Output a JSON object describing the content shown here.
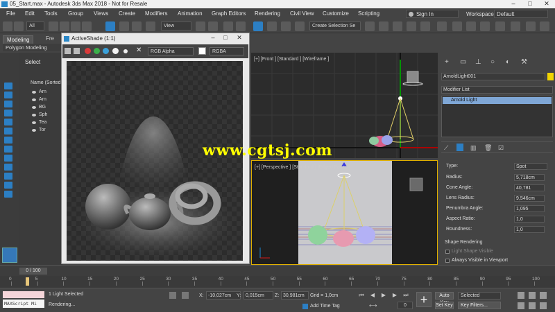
{
  "window": {
    "title": "05_Start.max - Autodesk 3ds Max 2018 - Not for Resale"
  },
  "menu": {
    "items": [
      "File",
      "Edit",
      "Tools",
      "Group",
      "Views",
      "Create",
      "Modifiers",
      "Animation",
      "Graph Editors",
      "Rendering",
      "Civil View",
      "Customize",
      "Scripting"
    ],
    "sign_in": "Sign In",
    "workspaces_label": "Workspaces:",
    "workspace_value": "Default"
  },
  "toolbar": {
    "filter_value": "All",
    "view_value": "View",
    "selection_set": "Create Selection Se"
  },
  "ribbon": {
    "tabs": [
      "Modeling",
      "Fre"
    ],
    "sub_label": "Polygon Modeling"
  },
  "scene_explorer": {
    "title": "Select",
    "column_header": "Name (Sorted",
    "rows": [
      "Arn",
      "Arn",
      "BG",
      "Sph",
      "Tea",
      "Tor"
    ]
  },
  "activeshade": {
    "title": "ActiveShade (1:1)",
    "channel": "RGB Alpha",
    "display": "RGBA",
    "colors": {
      "red": "#d93a3a",
      "green": "#3ab04a",
      "blue": "#3aa0d9"
    }
  },
  "viewports": {
    "front_label": "[+] [Front ] [Standard ] [Wireframe ]",
    "persp_label": "[+] [Perspective ] [Standard ] [Edged Faces ]"
  },
  "command_panel": {
    "object_name": "ArnoldLight001",
    "object_color": "#f2d400",
    "modifier_list": "Modifier List",
    "stack_item": "Arnold Light",
    "params": [
      {
        "label": "Type:",
        "value": "Spot"
      },
      {
        "label": "Radius:",
        "value": "5,718cm"
      },
      {
        "label": "Cone Angle:",
        "value": "40,781"
      },
      {
        "label": "Lens Radius:",
        "value": "9,546cm"
      },
      {
        "label": "Penumbra Angle:",
        "value": "1,095"
      },
      {
        "label": "Aspect Ratio:",
        "value": "1,0"
      },
      {
        "label": "Roundness:",
        "value": "1,0"
      }
    ],
    "shape_section": "Shape Rendering",
    "light_shape_visible": "Light Shape Visible",
    "always_visible": "Always Visible in Viewport"
  },
  "timeline": {
    "slider": "0 / 100",
    "ticks": [
      "0",
      "5",
      "10",
      "15",
      "20",
      "25",
      "30",
      "35",
      "40",
      "45",
      "50",
      "55",
      "60",
      "65",
      "70",
      "75",
      "80",
      "85",
      "90",
      "95",
      "100"
    ]
  },
  "status": {
    "maxscript": "MAXScript Mi",
    "selection": "1 Light Selected",
    "prompt": "Rendering...",
    "x_label": "X:",
    "x_value": "-10,027cm",
    "y_label": "Y:",
    "y_value": "0,015cm",
    "z_label": "Z:",
    "z_value": "30,981cm",
    "grid": "Grid = 1,0cm",
    "add_time_tag": "Add Time Tag",
    "frame": "0",
    "auto_key": "Auto Key",
    "set_key": "Set Key",
    "selected": "Selected",
    "key_filters": "Key Filters..."
  },
  "watermark": "www.cgtsj.com"
}
